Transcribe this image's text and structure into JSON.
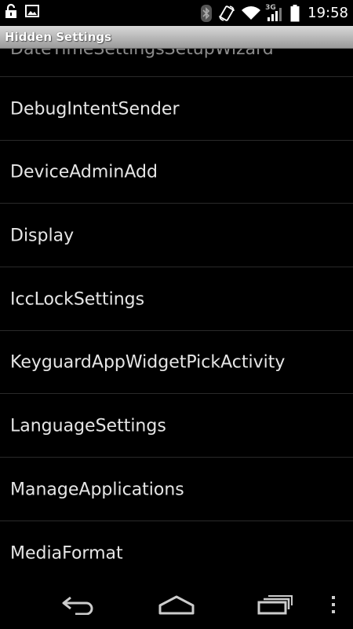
{
  "status_bar": {
    "time": "19:58",
    "network_type": "3G",
    "icons_left": [
      "unlock-icon",
      "image-icon"
    ],
    "icons_right": [
      "bluetooth-icon",
      "rotate-icon",
      "wifi-icon",
      "signal-icon",
      "battery-icon"
    ]
  },
  "title_bar": {
    "title": "Hidden Settings"
  },
  "list": {
    "partial_item": "DateTimeSettingsSetupWizard",
    "items": [
      "DebugIntentSender",
      "DeviceAdminAdd",
      "Display",
      "IccLockSettings",
      "KeyguardAppWidgetPickActivity",
      "LanguageSettings",
      "ManageApplications",
      "MediaFormat"
    ]
  },
  "nav_bar": {
    "buttons": [
      "back-icon",
      "home-icon",
      "recent-apps-icon",
      "overflow-menu-icon"
    ]
  },
  "colors": {
    "background": "#000000",
    "text": "#e6e6e6",
    "divider": "#2a2a2a",
    "title_bar_top": "#d9d9d9",
    "title_bar_bottom": "#9a9a9a"
  }
}
